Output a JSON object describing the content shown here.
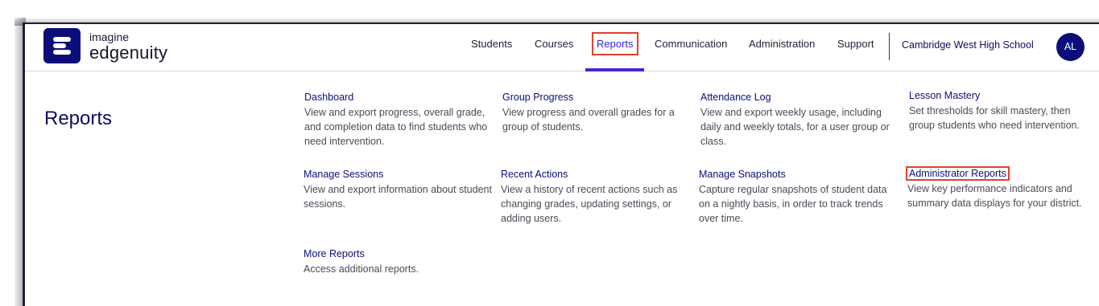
{
  "brand": {
    "line1": "imagine",
    "line2": "edgenuity",
    "tile_color": "#0b0e79"
  },
  "nav": {
    "items": [
      "Students",
      "Courses",
      "Reports",
      "Communication",
      "Administration",
      "Support"
    ],
    "active": "Reports",
    "school": "Cambridge West High School",
    "avatar_initials": "AL"
  },
  "page": {
    "title": "Reports"
  },
  "reports": [
    {
      "title": "Dashboard",
      "desc": "View and export progress, overall grade, and completion data to find students who need intervention."
    },
    {
      "title": "Group Progress",
      "desc": "View progress and overall grades for a group of students."
    },
    {
      "title": "Attendance Log",
      "desc": "View and export weekly usage, including daily and weekly totals, for a user group or class."
    },
    {
      "title": "Lesson Mastery",
      "desc": "Set thresholds for skill mastery, then group students who need intervention."
    },
    {
      "title": "Manage Sessions",
      "desc": "View and export information about student sessions."
    },
    {
      "title": "Recent Actions",
      "desc": "View a history of recent actions such as changing grades, updating settings, or adding users."
    },
    {
      "title": "Manage Snapshots",
      "desc": "Capture regular snapshots of student data on a nightly basis, in order to track trends over time."
    },
    {
      "title": "Administrator Reports",
      "desc": "View key performance indicators and summary data displays for your district."
    },
    {
      "title": "More Reports",
      "desc": "Access additional reports."
    }
  ],
  "colors": {
    "accent": "#4a23d6",
    "navy": "#0b0e79",
    "highlight": "#e0412c"
  }
}
